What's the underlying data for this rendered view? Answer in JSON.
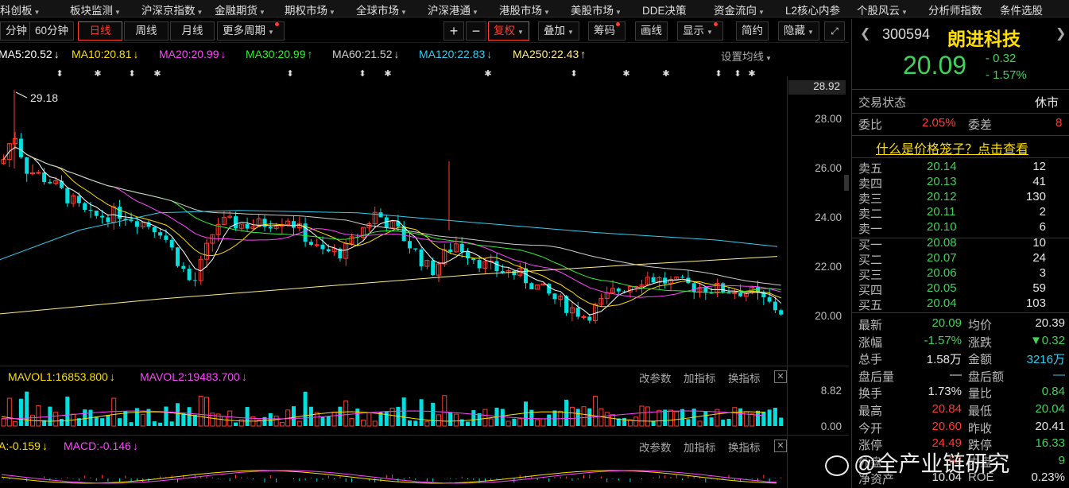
{
  "top_menu": [
    {
      "label": "科创板",
      "arrow": "▼"
    },
    {
      "label": "板块监测",
      "arrow": "▼"
    },
    {
      "label": "沪深京指数",
      "arrow": "▼"
    },
    {
      "label": "金融期货",
      "arrow": "▼"
    },
    {
      "label": "期权市场",
      "arrow": "▼"
    },
    {
      "label": "全球市场",
      "arrow": "▼"
    },
    {
      "label": "沪深港通",
      "arrow": "▼"
    },
    {
      "label": "港股市场",
      "arrow": "▼"
    },
    {
      "label": "美股市场",
      "arrow": "▼"
    },
    {
      "label": "DDE决策",
      "arrow": ""
    },
    {
      "label": "资金流向",
      "arrow": "▼"
    },
    {
      "label": "L2核心内参",
      "arrow": ""
    },
    {
      "label": "个股风云",
      "arrow": "▼"
    },
    {
      "label": "分析师指数",
      "arrow": ""
    },
    {
      "label": "条件选股",
      "arrow": ""
    }
  ],
  "toolbar": {
    "period_buttons": [
      "分钟",
      "60分钟",
      "日线",
      "周线",
      "月线"
    ],
    "active_period": "日线",
    "more_periods": "更多周期",
    "plus": "+",
    "minus": "−",
    "fuquan": "复权",
    "overlay": "叠加",
    "chips": "筹码",
    "draw": "画线",
    "display": "显示",
    "simple": "简约",
    "hide": "隐藏",
    "expand_icon": "expand-icon"
  },
  "ma_legend": [
    {
      "label": "MA5:20.52",
      "arrow": "↓",
      "color": "#ffffff"
    },
    {
      "label": "MA10:20.81",
      "arrow": "↓",
      "color": "#ffde00"
    },
    {
      "label": "MA20:20.99",
      "arrow": "↓",
      "color": "#ff44ff"
    },
    {
      "label": "MA30:20.99",
      "arrow": "↑",
      "color": "#33ee33"
    },
    {
      "label": "MA60:21.52",
      "arrow": "↓",
      "color": "#cfcfcf"
    },
    {
      "label": "MA120:22.83",
      "arrow": "↓",
      "color": "#33ccee"
    },
    {
      "label": "MA250:22.43",
      "arrow": "↑",
      "color": "#ffee88"
    }
  ],
  "ma_settings": "设置均线",
  "price_axis": [
    "28.92",
    "28.00",
    "26.00",
    "24.00",
    "22.00",
    "20.00"
  ],
  "price_axis_values": [
    28.92,
    28,
    26,
    24,
    22,
    20
  ],
  "high_marker": "29.18",
  "volume_panel": {
    "legend": [
      {
        "label": "MAVOL1:16853.800",
        "arrow": "↓",
        "color": "#ffde00"
      },
      {
        "label": "MAVOL2:19483.700",
        "arrow": "↓",
        "color": "#ff44ff"
      }
    ],
    "axis": [
      "8.82",
      "0.00"
    ],
    "buttons": [
      "改参数",
      "加指标",
      "换指标"
    ]
  },
  "macd_panel": {
    "legend": [
      {
        "label": "A:-0.159",
        "arrow": "↓",
        "color": "#ffde00"
      },
      {
        "label": "MACD:-0.146",
        "arrow": "↓",
        "color": "#ff44ff"
      }
    ],
    "buttons": [
      "改参数",
      "加指标",
      "换指标"
    ]
  },
  "quote": {
    "code": "300594",
    "name": "朗进科技",
    "price": "20.09",
    "change": "- 0.32",
    "change_pct": "- 1.57%",
    "trade_status_label": "交易状态",
    "trade_status": "休市",
    "weibi_label": "委比",
    "weibi": "2.05%",
    "weicha_label": "委差",
    "weicha": "8",
    "cage_link": "什么是价格笼子？点击查看"
  },
  "order_book": {
    "asks": [
      {
        "label": "卖五",
        "price": "20.14",
        "vol": "12"
      },
      {
        "label": "卖四",
        "price": "20.13",
        "vol": "41"
      },
      {
        "label": "卖三",
        "price": "20.12",
        "vol": "130"
      },
      {
        "label": "卖二",
        "price": "20.11",
        "vol": "2"
      },
      {
        "label": "卖一",
        "price": "20.10",
        "vol": "6"
      }
    ],
    "bids": [
      {
        "label": "买一",
        "price": "20.08",
        "vol": "10"
      },
      {
        "label": "买二",
        "price": "20.07",
        "vol": "24"
      },
      {
        "label": "买三",
        "price": "20.06",
        "vol": "3"
      },
      {
        "label": "买四",
        "price": "20.05",
        "vol": "59"
      },
      {
        "label": "买五",
        "price": "20.04",
        "vol": "103"
      }
    ]
  },
  "stats": [
    {
      "k1": "最新",
      "v1": "20.09",
      "c1": "#3fd35a",
      "k2": "均价",
      "v2": "20.39",
      "c2": "#e6e6e6"
    },
    {
      "k1": "涨幅",
      "v1": "-1.57%",
      "c1": "#3fd35a",
      "k2": "涨跌",
      "v2": "▼0.32",
      "c2": "#3fd35a"
    },
    {
      "k1": "总手",
      "v1": "1.58万",
      "c1": "#e6e6e6",
      "k2": "金额",
      "v2": "3216万",
      "c2": "#33ccee"
    },
    {
      "k1": "盘后量",
      "v1": "—",
      "c1": "#e6e6e6",
      "k2": "盘后额",
      "v2": "—",
      "c2": "#33ccee"
    },
    {
      "k1": "换手",
      "v1": "1.73%",
      "c1": "#e6e6e6",
      "k2": "量比",
      "v2": "0.84",
      "c2": "#3fd35a"
    },
    {
      "k1": "最高",
      "v1": "20.84",
      "c1": "#ff3b30",
      "k2": "最低",
      "v2": "20.04",
      "c2": "#3fd35a"
    },
    {
      "k1": "今开",
      "v1": "20.60",
      "c1": "#ff3b30",
      "k2": "昨收",
      "v2": "20.41",
      "c2": "#e6e6e6"
    },
    {
      "k1": "涨停",
      "v1": "24.49",
      "c1": "#ff3b30",
      "k2": "跌停",
      "v2": "16.33",
      "c2": "#3fd35a"
    },
    {
      "k1": "外盘",
      "v1": "62",
      "c1": "#ff3b30",
      "k2": "内盘",
      "v2": "9",
      "c2": "#3fd35a"
    },
    {
      "k1": "净资产",
      "v1": "10.04",
      "c1": "#e6e6e6",
      "k2": "ROE",
      "v2": "0.23%",
      "c2": "#e6e6e6"
    }
  ],
  "watermark": "@全产业链研究",
  "colors": {
    "up": "#ff3b30",
    "down": "#00e0e0",
    "green": "#3fd35a",
    "cyan": "#33ccee"
  }
}
